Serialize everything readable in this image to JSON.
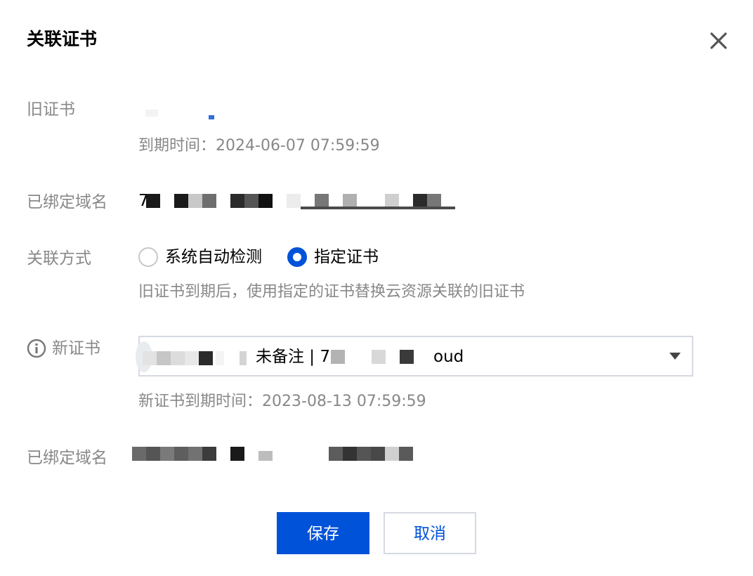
{
  "dialog": {
    "title": "关联证书",
    "close_icon": "close-icon"
  },
  "old_cert": {
    "label": "旧证书",
    "expiry_label": "到期时间：",
    "expiry_value": "2024-06-07 07:59:59"
  },
  "bound_domain_old": {
    "label": "已绑定域名",
    "value_visible_start": "7",
    "value_visible_end": "www.7 67 2862.cloud"
  },
  "association": {
    "label": "关联方式",
    "options": [
      {
        "label": "系统自动检测",
        "checked": false
      },
      {
        "label": "指定证书",
        "checked": true
      }
    ],
    "hint": "旧证书到期后，使用指定的证书替换云资源关联的旧证书"
  },
  "new_cert": {
    "label": "新证书",
    "info_icon": "info-icon",
    "select_value_visible": "未备注 | 77",
    "select_value_tail": "oud",
    "caret_icon": "caret-down-icon",
    "expiry_label": "新证书到期时间：",
    "expiry_value": "2023-08-13 07:59:59"
  },
  "bound_domain_new": {
    "label": "已绑定域名"
  },
  "buttons": {
    "save": "保存",
    "cancel": "取消"
  },
  "colors": {
    "primary": "#0052d9",
    "label_gray": "#888888",
    "border": "#d6d9e0"
  }
}
